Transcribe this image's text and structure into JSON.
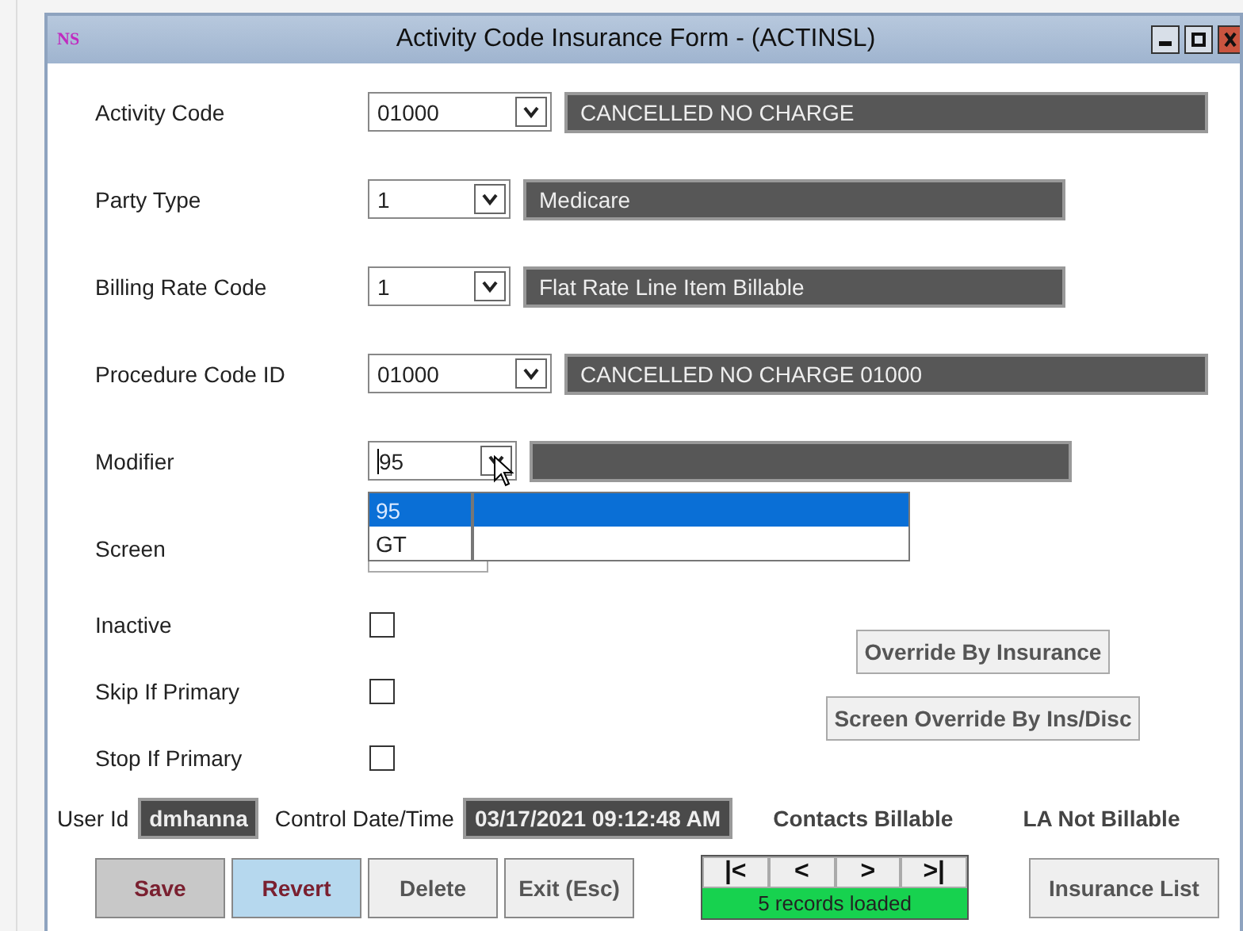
{
  "window": {
    "logo": "NS",
    "title": "Activity Code Insurance Form - (ACTINSL)"
  },
  "fields": [
    {
      "label": "Activity Code",
      "kind": "select",
      "value": "01000",
      "description": "CANCELLED NO CHARGE"
    },
    {
      "label": "Party Type",
      "kind": "select",
      "value": "1",
      "description": "Medicare"
    },
    {
      "label": "Billing Rate Code",
      "kind": "select",
      "value": "1",
      "description": "Flat Rate Line Item Billable"
    },
    {
      "label": "Procedure Code ID",
      "kind": "select",
      "value": "01000",
      "description": "CANCELLED NO CHARGE 01000"
    },
    {
      "label": "Modifier",
      "kind": "select",
      "value": "95",
      "options": [
        {
          "label": "95",
          "selected": true
        },
        {
          "label": "GT",
          "selected": false
        }
      ]
    },
    {
      "label": "Screen",
      "kind": "text"
    }
  ],
  "checkboxes": [
    {
      "label": "Inactive",
      "checked": false
    },
    {
      "label": "Skip If Primary",
      "checked": false
    },
    {
      "label": "Stop If Primary",
      "checked": false
    }
  ],
  "side_buttons": [
    "Override By Insurance",
    "Screen Override By Ins/Disc"
  ],
  "info": {
    "user_id_label": "User Id",
    "user_id": "dmhanna",
    "control_label": "Control Date/Time",
    "control_value": "03/17/2021 09:12:48 AM",
    "flags": [
      "Contacts Billable",
      "LA Not Billable"
    ]
  },
  "buttons": [
    {
      "label": "Save",
      "kind": "save"
    },
    {
      "label": "Revert",
      "kind": "revert"
    },
    {
      "label": "Delete",
      "kind": "plain"
    },
    {
      "label": "Exit (Esc)",
      "kind": "plain"
    }
  ],
  "navigator": {
    "buttons": [
      "|<",
      "<",
      ">",
      ">|"
    ],
    "status": "5 records loaded"
  },
  "list_button": "Insurance List"
}
